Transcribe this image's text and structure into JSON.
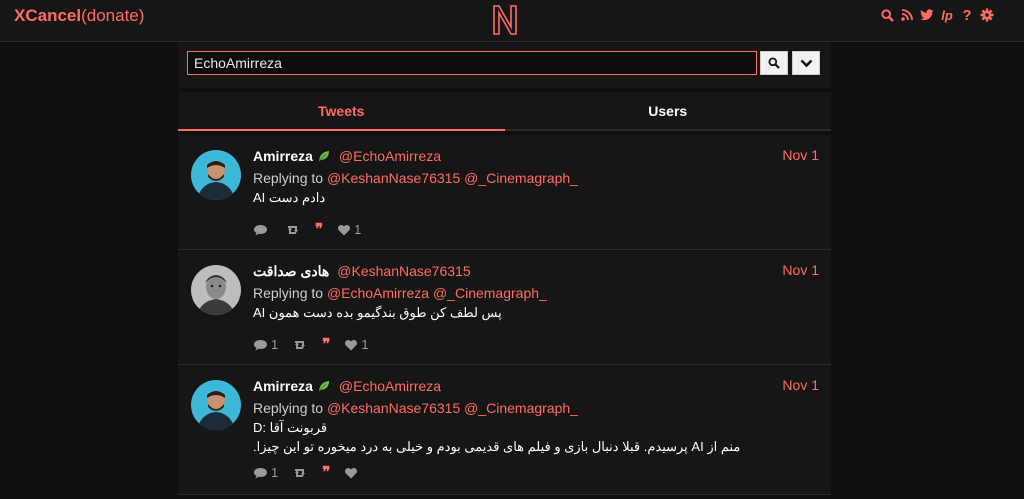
{
  "header": {
    "brand_bold": "XCancel",
    "brand_rest": "(donate)",
    "logo_letter": "N",
    "icons": [
      "search-icon",
      "rss-icon",
      "twitter-icon",
      "lp-icon",
      "help-icon",
      "settings-icon"
    ],
    "lp": "lp",
    "help": "?"
  },
  "search": {
    "value": "EchoAmirreza"
  },
  "tabs": [
    {
      "label": "Tweets",
      "active": true
    },
    {
      "label": "Users",
      "active": false
    }
  ],
  "tweets": [
    {
      "name": "Amirreza",
      "leaf": true,
      "handle": "@EchoAmirreza",
      "date": "Nov 1",
      "replying_prefix": "Replying to",
      "replying": [
        "@KeshanNase76315",
        "@_Cinemagraph_"
      ],
      "text": "دادم دست AI",
      "text2": "",
      "comments": "",
      "likes": "1"
    },
    {
      "name": "هادی صداقت",
      "leaf": false,
      "handle": "@KeshanNase76315",
      "date": "Nov 1",
      "replying_prefix": "Replying to",
      "replying": [
        "@EchoAmirreza",
        "@_Cinemagraph_"
      ],
      "text": "پس لطف کن طوق بندگیمو بده دست همون AI",
      "text2": "",
      "comments": "1",
      "likes": "1"
    },
    {
      "name": "Amirreza",
      "leaf": true,
      "handle": "@EchoAmirreza",
      "date": "Nov 1",
      "replying_prefix": "Replying to",
      "replying": [
        "@KeshanNase76315",
        "@_Cinemagraph_"
      ],
      "text": "قربونت آقا :D",
      "text2": "منم از AI پرسیدم. قبلا دنبال بازی و فیلم های قدیمی بودم و خیلی به درد میخوره تو این چیزا.",
      "comments": "1",
      "likes": ""
    }
  ],
  "colors": {
    "accent": "#ff6c60",
    "bg": "#0f0f0f",
    "panel": "#161616"
  }
}
